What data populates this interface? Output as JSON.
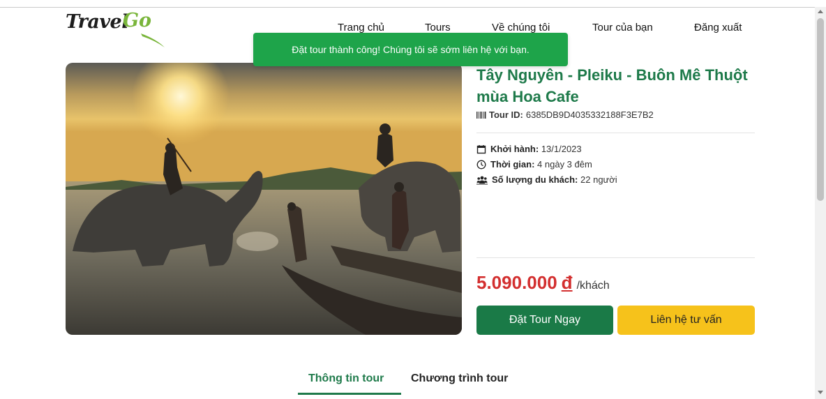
{
  "header": {
    "logo_travel": "Travel",
    "logo_go": "Go",
    "nav": [
      {
        "label": "Trang chủ"
      },
      {
        "label": "Tours"
      },
      {
        "label": "Về chúng tôi"
      },
      {
        "label": "Tour của bạn"
      },
      {
        "label": "Đăng xuất"
      }
    ]
  },
  "toast": {
    "message": "Đặt tour thành công! Chúng tôi sẽ sớm liên hệ với bạn."
  },
  "tour": {
    "title": "Tây Nguyên - Pleiku - Buôn Mê Thuột mùa Hoa Cafe",
    "id_label": "Tour ID:",
    "id_value": "6385DB9D4035332188F3E7B2",
    "departure_label": "Khởi hành:",
    "departure_value": "13/1/2023",
    "duration_label": "Thời gian:",
    "duration_value": "4 ngày 3 đêm",
    "guests_label": "Số lượng du khách:",
    "guests_value": "22 người",
    "price": "5.090.000",
    "currency": "đ",
    "price_unit": "/khách",
    "book_label": "Đặt Tour Ngay",
    "consult_label": "Liên hệ tư vấn"
  },
  "tabs": [
    {
      "label": "Thông tin tour",
      "active": true
    },
    {
      "label": "Chương trình tour",
      "active": false
    }
  ],
  "colors": {
    "brand_green": "#1e7a4a",
    "toast_green": "#1ea44a",
    "price_red": "#d32f2f",
    "consult_yellow": "#f6c21b",
    "logo_green": "#79b53a"
  }
}
